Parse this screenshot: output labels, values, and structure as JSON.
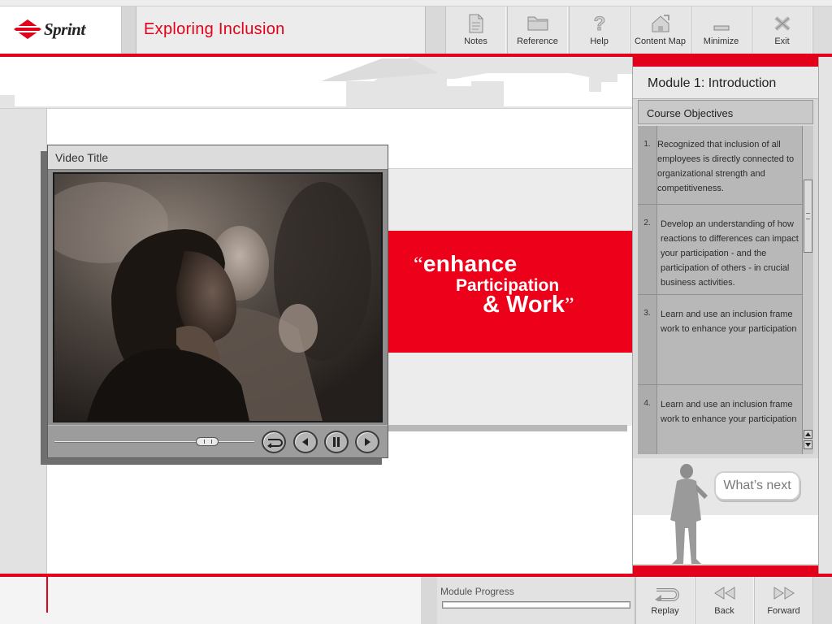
{
  "brand": {
    "logo_text": "Sprint",
    "brand_color": "#e3001b"
  },
  "course": {
    "title": "Exploring Inclusion"
  },
  "toolbar": {
    "items": [
      {
        "label": "Notes",
        "icon": "notes-icon"
      },
      {
        "label": "Reference",
        "icon": "folder-icon"
      },
      {
        "label": "Help",
        "icon": "help-icon"
      },
      {
        "label": "Content Map",
        "icon": "content-map-icon"
      },
      {
        "label": "Minimize",
        "icon": "minimize-icon"
      },
      {
        "label": "Exit",
        "icon": "close-icon"
      }
    ]
  },
  "video": {
    "title": "Video Title",
    "progress": 0.8,
    "controls": [
      "replay-icon",
      "rewind-icon",
      "pause-icon",
      "play-icon"
    ]
  },
  "quote": {
    "open_mark": "“",
    "line1": "enhance",
    "line2": "Participation",
    "line3": "& Work",
    "close_mark": "”",
    "background": "#ed0019"
  },
  "panel": {
    "module_title": "Module 1: Introduction",
    "objectives_title": "Course Objectives",
    "objectives": [
      {
        "num": "1.",
        "text": "Recognized that inclusion of all employees is directly connected to organizational strength and competitiveness."
      },
      {
        "num": "2.",
        "text": "Develop an understanding of how reactions to differences can impact your participation - and the participation of others - in crucial business activities."
      },
      {
        "num": "3.",
        "text": "Learn and use an inclusion frame work to enhance your participation"
      },
      {
        "num": "4.",
        "text": "Learn and use an inclusion frame work to enhance your participation"
      }
    ],
    "whats_next_label": "What’s next"
  },
  "footer": {
    "module_progress_label": "Module Progress",
    "module_progress": 0.0,
    "nav": [
      {
        "label": "Replay",
        "icon": "replay-icon"
      },
      {
        "label": "Back",
        "icon": "back-icon"
      },
      {
        "label": "Forward",
        "icon": "forward-icon"
      }
    ]
  }
}
